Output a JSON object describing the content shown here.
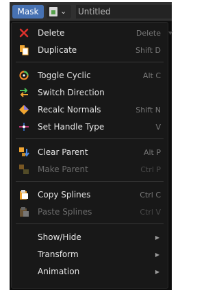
{
  "header": {
    "mode_label": "Mask",
    "datablock_name": "Untitled"
  },
  "menu": {
    "items": [
      {
        "label": "Delete",
        "shortcut": "Delete",
        "icon": "x-icon",
        "disabled": false
      },
      {
        "label": "Duplicate",
        "shortcut": "Shift D",
        "icon": "duplicate-icon",
        "disabled": false
      },
      {
        "label": "Toggle Cyclic",
        "shortcut": "Alt C",
        "icon": "cyclic-icon",
        "disabled": false
      },
      {
        "label": "Switch Direction",
        "shortcut": "",
        "icon": "switch-direction-icon",
        "disabled": false
      },
      {
        "label": "Recalc Normals",
        "shortcut": "Shift N",
        "icon": "normals-icon",
        "disabled": false
      },
      {
        "label": "Set Handle Type",
        "shortcut": "V",
        "icon": "handle-type-icon",
        "disabled": false
      },
      {
        "label": "Clear Parent",
        "shortcut": "Alt P",
        "icon": "clear-parent-icon",
        "disabled": false
      },
      {
        "label": "Make Parent",
        "shortcut": "Ctrl P",
        "icon": "make-parent-icon",
        "disabled": true
      },
      {
        "label": "Copy Splines",
        "shortcut": "Ctrl C",
        "icon": "copy-icon",
        "disabled": false
      },
      {
        "label": "Paste Splines",
        "shortcut": "Ctrl V",
        "icon": "paste-icon",
        "disabled": true
      },
      {
        "label": "Show/Hide",
        "icon": "submenu-arrow-icon"
      },
      {
        "label": "Transform",
        "icon": "submenu-arrow-icon"
      },
      {
        "label": "Animation",
        "icon": "submenu-arrow-icon"
      }
    ]
  },
  "colors": {
    "accent": "#4772b3",
    "menu_bg": "#181818",
    "text": "#e6e6e6",
    "shortcut": "#7a7a7a",
    "disabled_text": "#6c6c6c"
  }
}
